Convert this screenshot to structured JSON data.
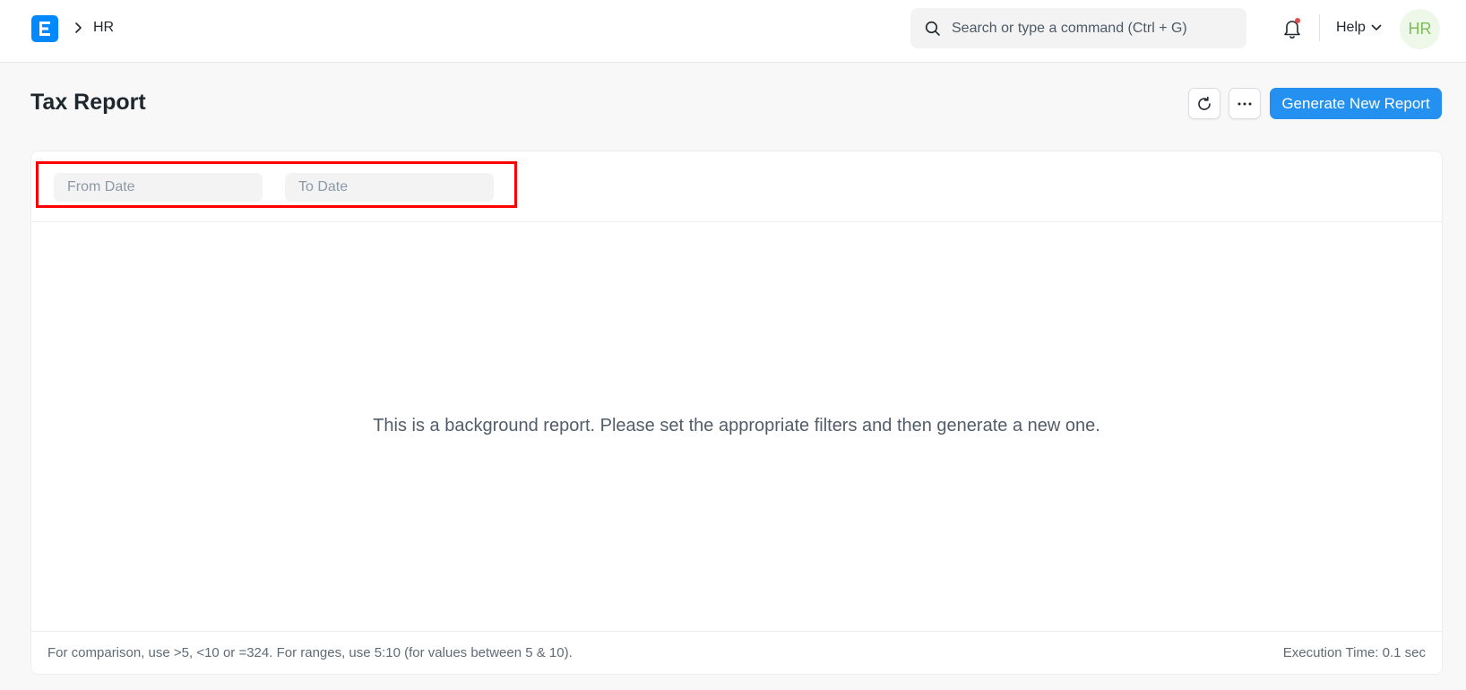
{
  "navbar": {
    "breadcrumb": "HR",
    "search_placeholder": "Search or type a command (Ctrl + G)",
    "help_label": "Help",
    "avatar_initials": "HR",
    "notification_dot_color": "#e24c4c"
  },
  "page": {
    "title": "Tax Report",
    "primary_action": "Generate New Report"
  },
  "filters": {
    "from_date_placeholder": "From Date",
    "to_date_placeholder": "To Date"
  },
  "report": {
    "message": "This is a background report. Please set the appropriate filters and then generate a new one."
  },
  "footer": {
    "hint": "For comparison, use >5, <10 or =324. For ranges, use 5:10 (for values between 5 & 10).",
    "execution_time": "Execution Time: 0.1 sec"
  },
  "colors": {
    "accent": "#2490ef",
    "highlight": "#ff0000",
    "logo": "#0089ff"
  },
  "icons": [
    "app-logo-icon",
    "chevron-right-icon",
    "search-icon",
    "bell-icon",
    "chevron-down-icon",
    "refresh-icon",
    "more-icon"
  ]
}
